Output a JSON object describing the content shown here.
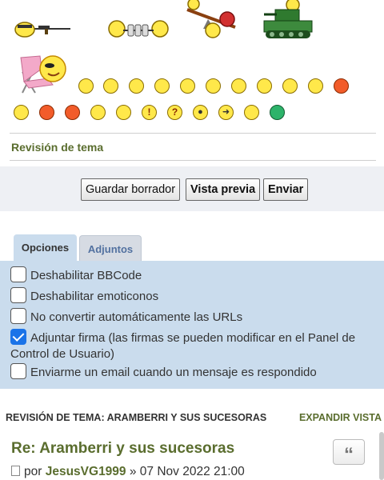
{
  "smilies": {
    "row1": [
      "sniper-smiley-icon",
      "weightlifter-smiley-icon",
      "seesaw-smiley-icon",
      "tank-smiley-icon"
    ],
    "row2": [
      "sunbathing-smiley-icon",
      "happy-smiley-icon",
      "smile-smiley-icon",
      "sad-smiley-icon",
      "surprised-smiley-icon",
      "eek-smiley-icon",
      "confused-smiley-icon",
      "cool-smiley-icon",
      "laughing-smiley-icon",
      "mad-smiley-icon",
      "razz-smiley-icon",
      "red-face-smiley-icon"
    ],
    "row3": [
      "geek-smiley-icon",
      "evil-smiley-icon",
      "twisted-smiley-icon",
      "rolleyes-smiley-icon",
      "wink-smiley-icon",
      "exclaim-smiley-icon",
      "question-smiley-icon",
      "idea-smiley-icon",
      "arrow-smiley-icon",
      "neutral-smiley-icon",
      "green-grin-smiley-icon"
    ]
  },
  "review_title": "Revisión de tema",
  "buttons": {
    "save_draft": "Guardar borrador",
    "preview": "Vista previa",
    "submit": "Enviar"
  },
  "tabs": {
    "options": "Opciones",
    "attachments": "Adjuntos"
  },
  "options": {
    "disable_bbcode": "Deshabilitar BBCode",
    "disable_smilies": "Deshabilitar emoticonos",
    "no_magic_url": "No convertir automáticamente las URLs",
    "attach_sig": "Adjuntar firma (las firmas se pueden modificar en el Panel de Control de Usuario)",
    "notify": "Enviarme un email cuando un mensaje es respondido"
  },
  "topic_review": {
    "heading": "REVISIÓN DE TEMA: ARAMBERRI Y SUS SUCESORAS",
    "expand": "EXPANDIR VISTA",
    "post_title": "Re: Aramberri y sus sucesoras",
    "quote_glyph": "“",
    "by": "por",
    "author": "JesusVG1999",
    "separator": "»",
    "date": "07 Nov 2022 21:00"
  },
  "colors": {
    "accent_olive": "#5a6d2e",
    "panel_blue": "#cadced",
    "checkbox_blue": "#1a73e8"
  }
}
